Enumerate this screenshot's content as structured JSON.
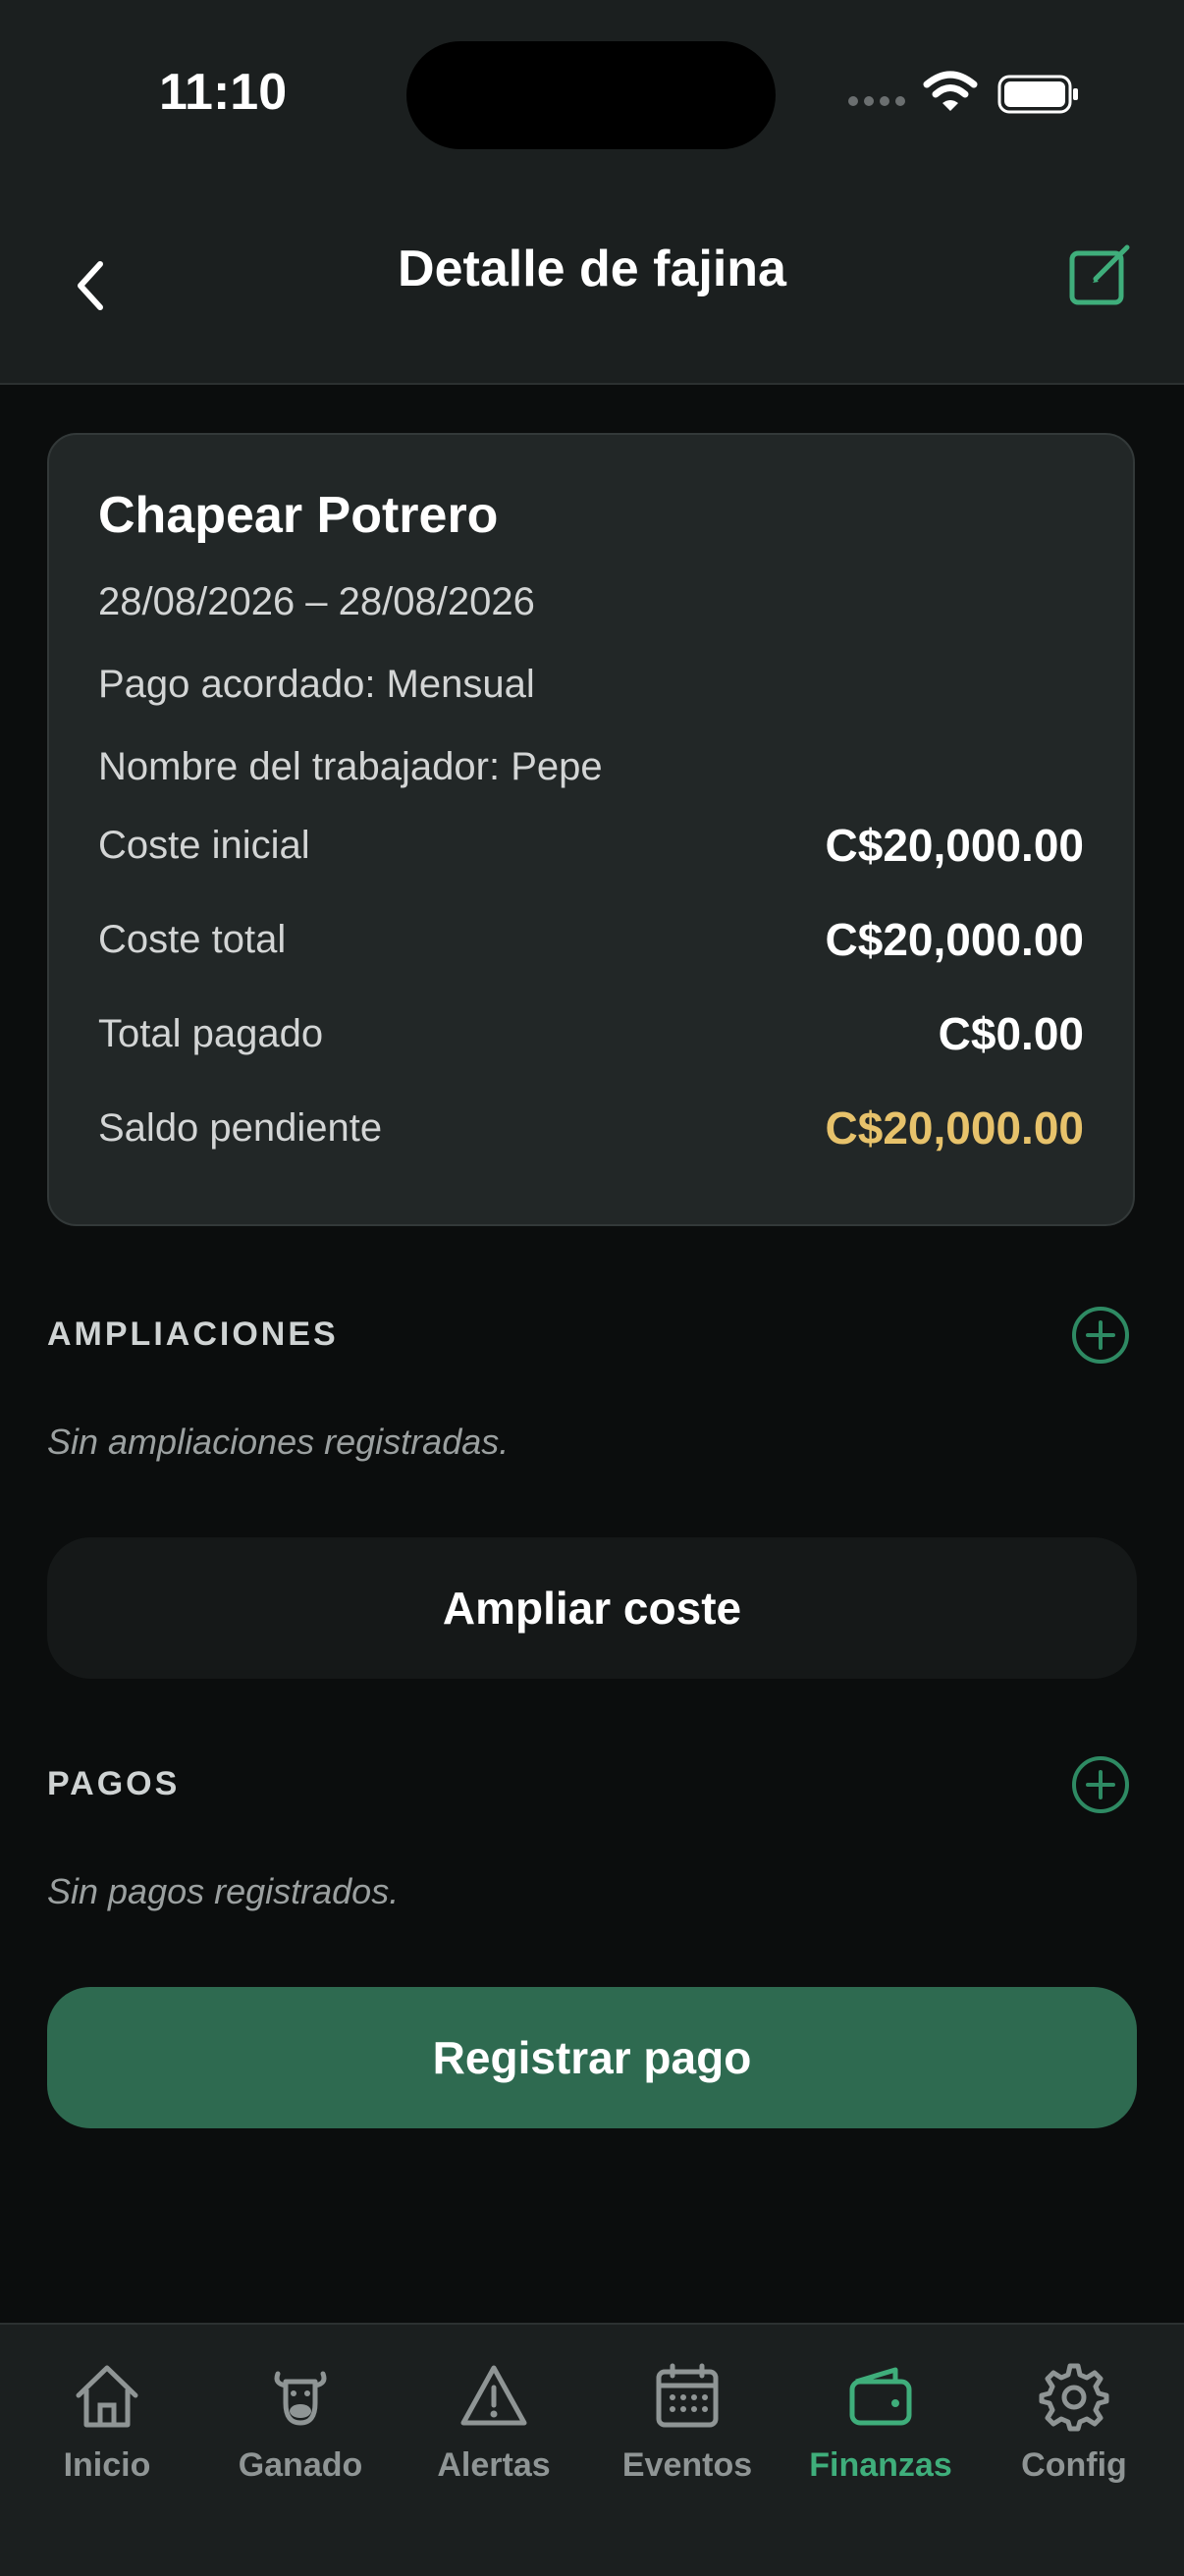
{
  "status_bar": {
    "time": "11:10"
  },
  "header": {
    "title": "Detalle de fajina"
  },
  "card": {
    "title": "Chapear Potrero",
    "date_range": "28/08/2026 – 28/08/2026",
    "agreed_payment": "Pago acordado: Mensual",
    "worker": "Nombre del trabajador: Pepe",
    "rows": [
      {
        "label": "Coste inicial",
        "value": "C$20,000.00"
      },
      {
        "label": "Coste total",
        "value": "C$20,000.00"
      },
      {
        "label": "Total pagado",
        "value": "C$0.00"
      },
      {
        "label": "Saldo pendiente",
        "value": "C$20,000.00"
      }
    ]
  },
  "ampliaciones": {
    "header": "AMPLIACIONES",
    "empty": "Sin ampliaciones registradas.",
    "button": "Ampliar coste"
  },
  "pagos": {
    "header": "PAGOS",
    "empty": "Sin pagos registrados.",
    "button": "Registrar pago"
  },
  "tabs": [
    {
      "label": "Inicio",
      "icon": "home-icon"
    },
    {
      "label": "Ganado",
      "icon": "cow-icon"
    },
    {
      "label": "Alertas",
      "icon": "warning-icon"
    },
    {
      "label": "Eventos",
      "icon": "calendar-icon"
    },
    {
      "label": "Finanzas",
      "icon": "wallet-icon",
      "active": true
    },
    {
      "label": "Config",
      "icon": "gear-icon"
    }
  ],
  "colors": {
    "accent": "#3fae7b",
    "primary_button": "#2e6a50",
    "pending": "#e7c26b",
    "background": "#0b0d0d",
    "card": "#222727"
  }
}
